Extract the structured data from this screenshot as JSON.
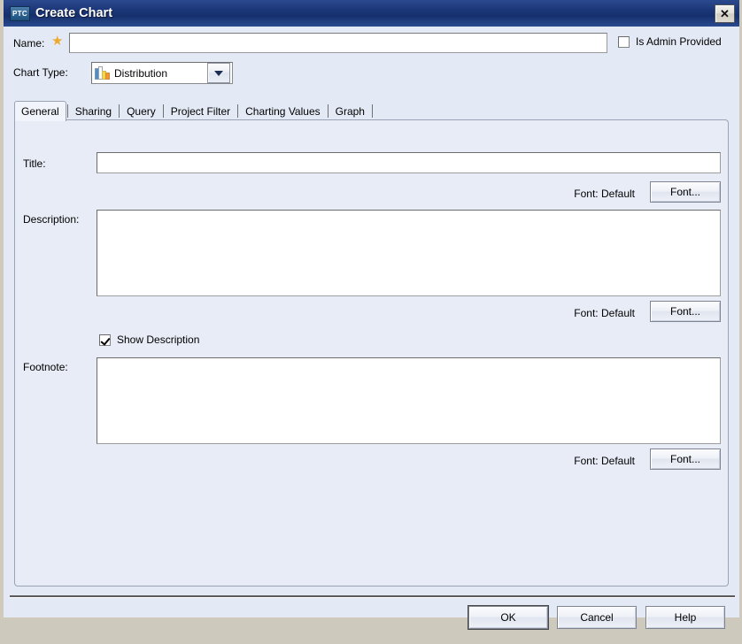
{
  "window": {
    "title": "Create Chart",
    "logo_text": "PTC",
    "close_label": "✕"
  },
  "form": {
    "name_label": "Name:",
    "name_value": "",
    "name_placeholder": "",
    "required_marker": "★",
    "admin_checkbox_label": "Is Admin Provided",
    "admin_checked": false,
    "chart_type_label": "Chart Type:",
    "chart_type_value": "Distribution"
  },
  "tabs": [
    {
      "label": "General",
      "selected": true
    },
    {
      "label": "Sharing",
      "selected": false
    },
    {
      "label": "Query",
      "selected": false
    },
    {
      "label": "Project Filter",
      "selected": false
    },
    {
      "label": "Charting Values",
      "selected": false
    },
    {
      "label": "Graph",
      "selected": false
    }
  ],
  "general": {
    "title_label": "Title:",
    "title_value": "",
    "title_font_note": "Font: Default",
    "title_font_button": "Font...",
    "description_label": "Description:",
    "description_value": "",
    "description_font_note": "Font: Default",
    "description_font_button": "Font...",
    "show_description_label": "Show Description",
    "show_description_checked": true,
    "footnote_label": "Footnote:",
    "footnote_value": "",
    "footnote_font_note": "Font: Default",
    "footnote_font_button": "Font..."
  },
  "buttons": {
    "ok": "OK",
    "cancel": "Cancel",
    "help": "Help"
  },
  "colors": {
    "titlebar_start": "#2b4a8e",
    "titlebar_end": "#16306d",
    "dialog_bg": "#e4eaf5",
    "panel_bg": "#e7ecf6",
    "required_star": "#eda92b",
    "frame": "#cfcabb"
  }
}
